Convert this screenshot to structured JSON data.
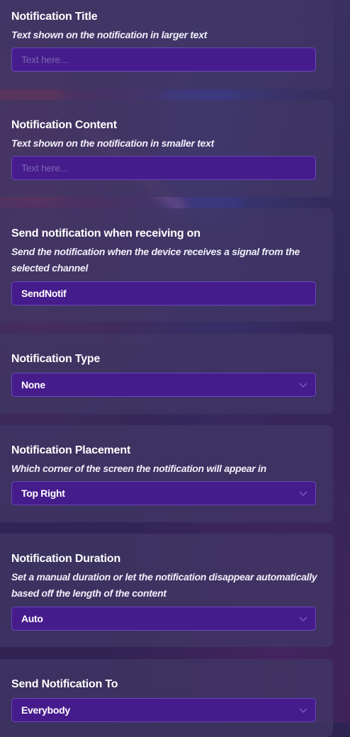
{
  "settings": [
    {
      "title": "Notification Title",
      "description": "Text shown on the notification in larger text",
      "input": {
        "value": "",
        "placeholder": "Text here..."
      }
    },
    {
      "title": "Notification Content",
      "description": "Text shown on the notification in smaller text",
      "input": {
        "value": "",
        "placeholder": "Text here..."
      }
    },
    {
      "title": "Send notification when receiving on",
      "description": "Send the notification when the device receives a signal from the selected channel",
      "input": {
        "value": "SendNotif"
      }
    },
    {
      "title": "Notification Type",
      "select": {
        "value": "None"
      }
    },
    {
      "title": "Notification Placement",
      "description": "Which corner of the screen the notification will appear in",
      "select": {
        "value": "Top Right"
      }
    },
    {
      "title": "Notification Duration",
      "description": "Set a manual duration or let the notification disappear automatically based off the length of the content",
      "select": {
        "value": "Auto"
      }
    },
    {
      "title": "Send Notification To",
      "select": {
        "value": "Everybody"
      }
    }
  ],
  "icons": {
    "dropdown": "chevron-down-icon"
  },
  "colors": {
    "field_background": "#461c8c",
    "field_border": "#6a46bd",
    "card_background": "#403664",
    "placeholder": "#7a64b0"
  }
}
